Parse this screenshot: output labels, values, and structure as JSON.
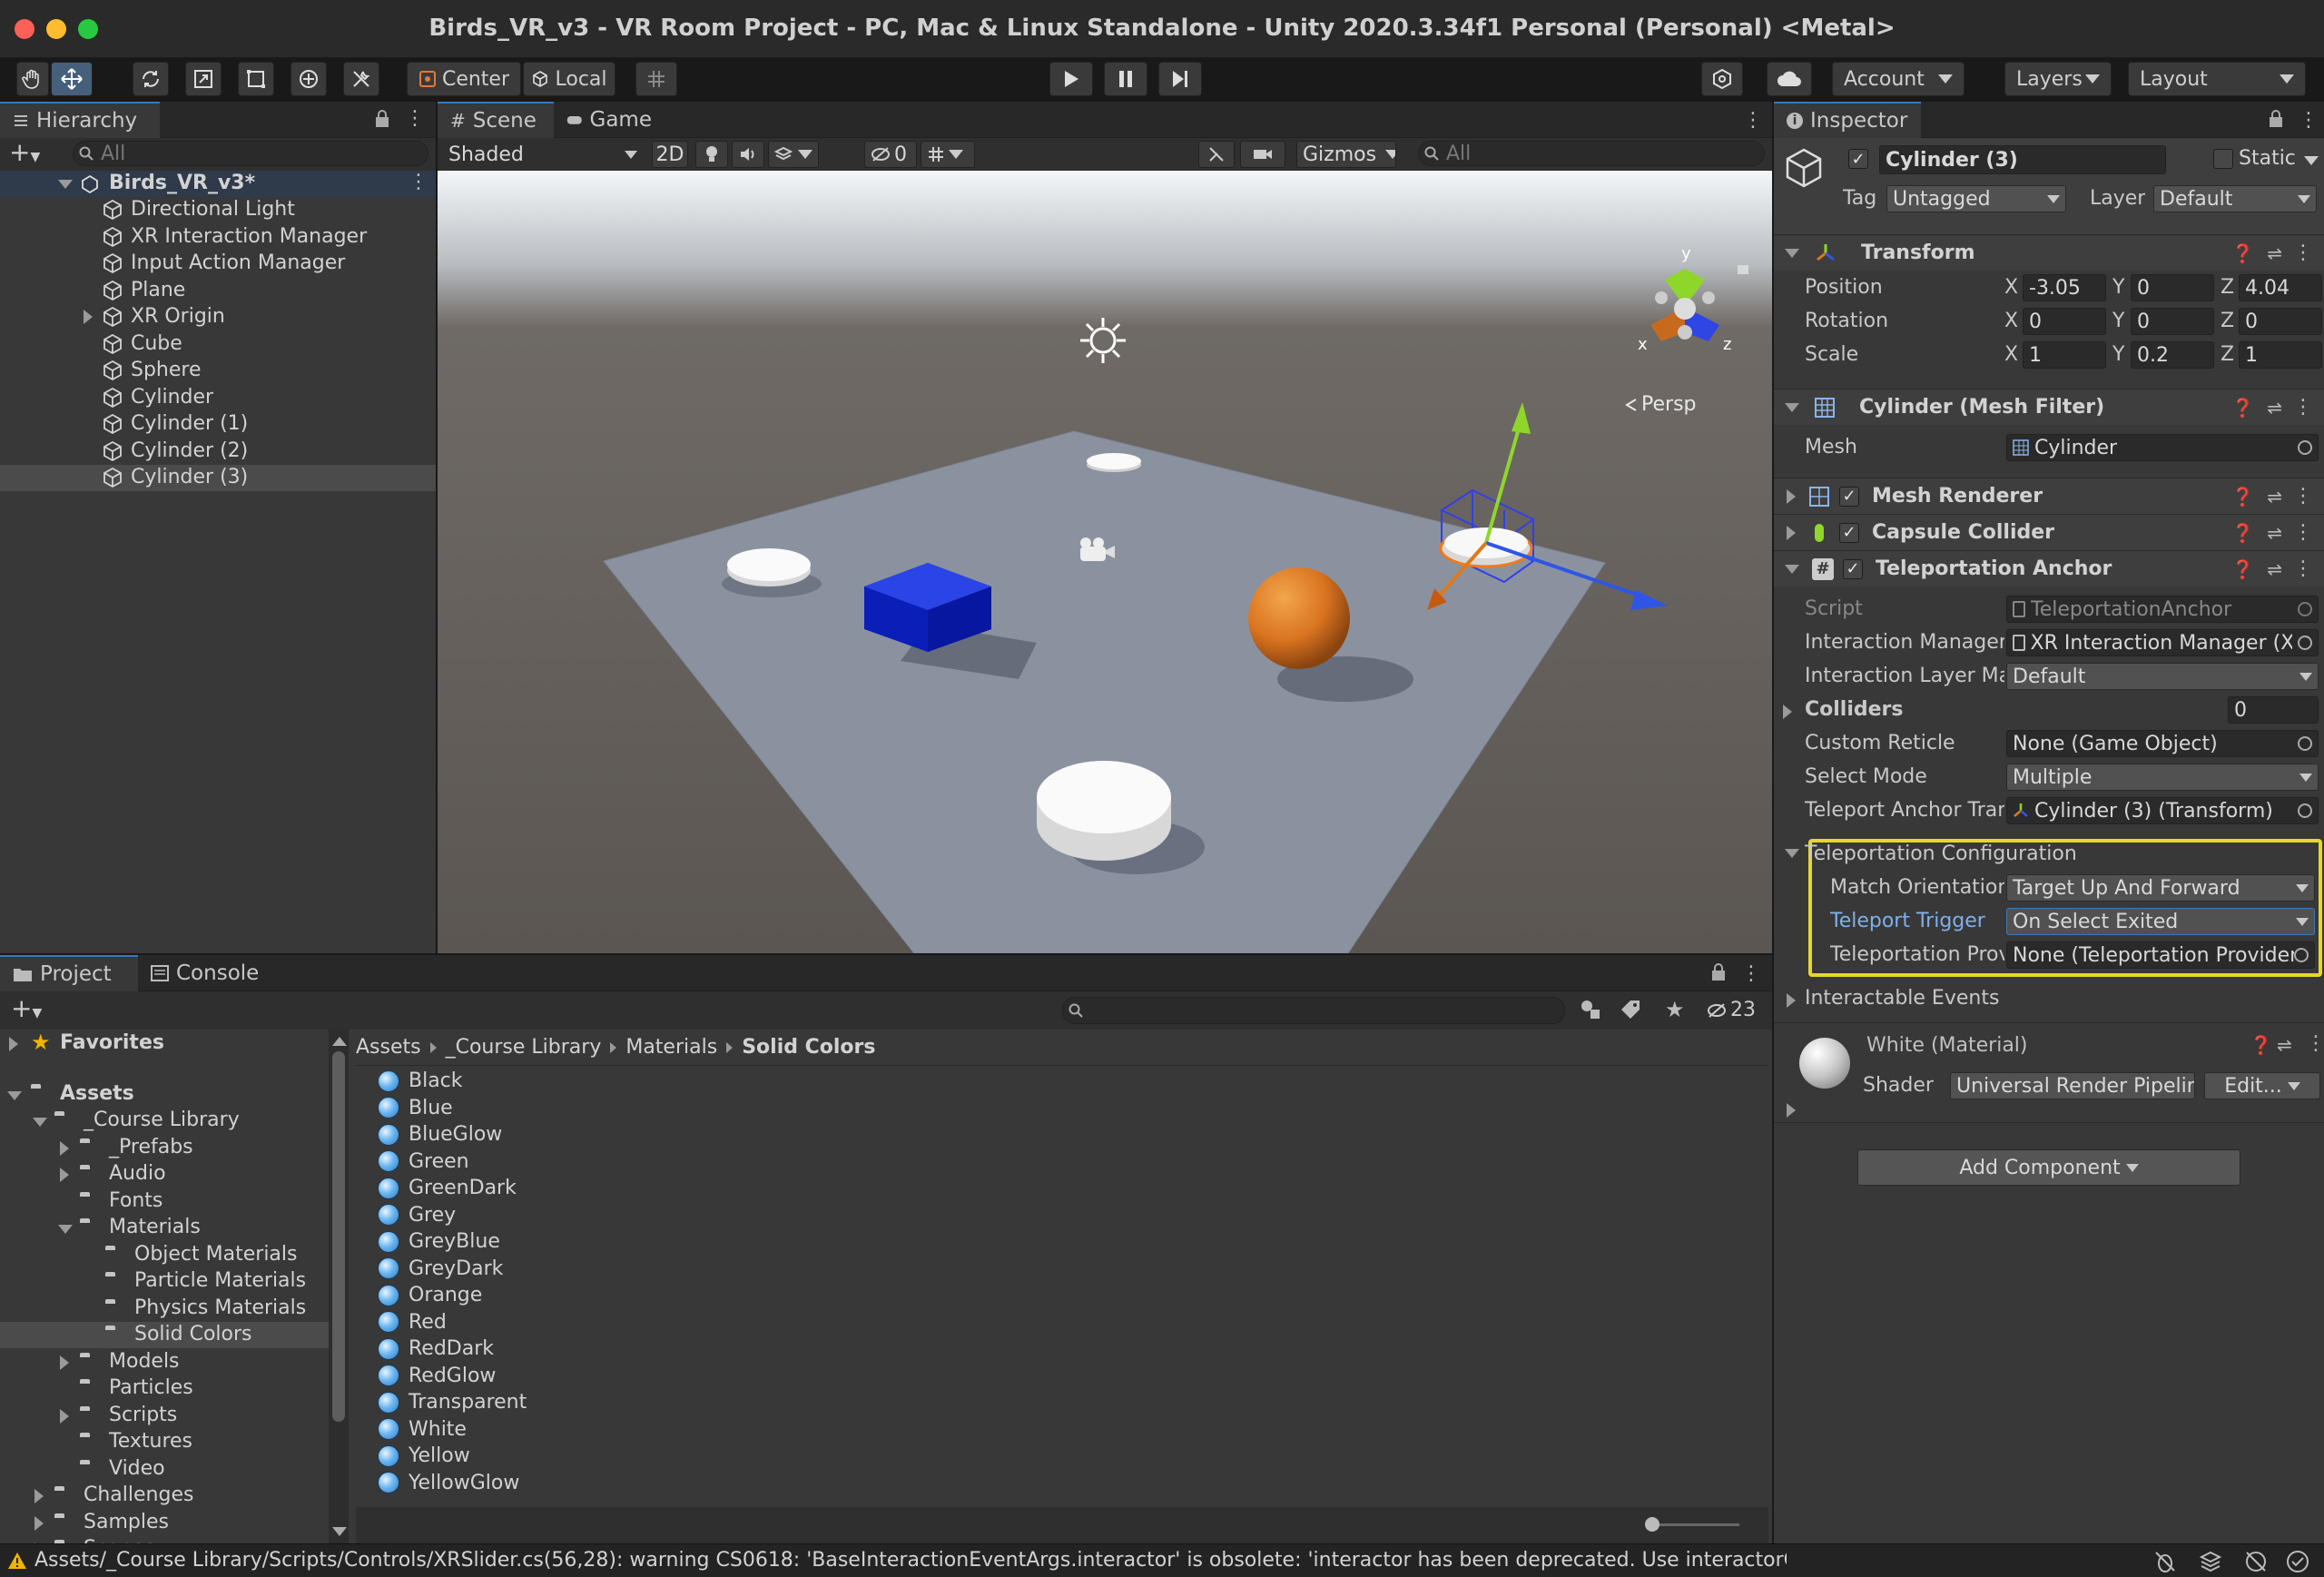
{
  "window": {
    "title": "Birds_VR_v3 - VR Room Project - PC, Mac & Linux Standalone - Unity 2020.3.34f1 Personal (Personal) <Metal>"
  },
  "toolbar": {
    "pivot": "Center",
    "space": "Local",
    "account": "Account",
    "layers": "Layers",
    "layout": "Layout"
  },
  "hierarchy": {
    "tab": "Hierarchy",
    "search_placeholder": "All",
    "scene_name": "Birds_VR_v3*",
    "items": [
      "Directional Light",
      "XR Interaction Manager",
      "Input Action Manager",
      "Plane",
      "XR Origin",
      "Cube",
      "Sphere",
      "Cylinder",
      "Cylinder (1)",
      "Cylinder (2)",
      "Cylinder (3)"
    ],
    "selected": "Cylinder (3)"
  },
  "scene": {
    "tab_scene": "Scene",
    "tab_game": "Game",
    "shading": "Shaded",
    "mode_2d": "2D",
    "hidden_count": "0",
    "gizmos": "Gizmos",
    "search_placeholder": "All",
    "persp": "Persp",
    "axis_x": "x",
    "axis_y": "y",
    "axis_z": "z"
  },
  "inspector": {
    "tab": "Inspector",
    "object_name": "Cylinder (3)",
    "static_label": "Static",
    "tag_label": "Tag",
    "tag_value": "Untagged",
    "layer_label": "Layer",
    "layer_value": "Default",
    "transform": {
      "title": "Transform",
      "position_label": "Position",
      "rotation_label": "Rotation",
      "scale_label": "Scale",
      "axis_x": "X",
      "axis_y": "Y",
      "axis_z": "Z",
      "position": [
        "-3.05",
        "0",
        "4.04"
      ],
      "rotation": [
        "0",
        "0",
        "0"
      ],
      "scale": [
        "1",
        "0.2",
        "1"
      ]
    },
    "mesh_filter": {
      "title": "Cylinder (Mesh Filter)",
      "mesh_label": "Mesh",
      "mesh_value": "Cylinder"
    },
    "mesh_renderer": {
      "title": "Mesh Renderer"
    },
    "capsule_collider": {
      "title": "Capsule Collider"
    },
    "teleport_anchor": {
      "title": "Teleportation Anchor",
      "script_label": "Script",
      "script_value": "TeleportationAnchor",
      "interaction_manager_label": "Interaction Manager",
      "interaction_manager_value": "XR Interaction Manager (XF",
      "layer_mask_label": "Interaction Layer Mas",
      "layer_mask_value": "Default",
      "colliders_label": "Colliders",
      "colliders_value": "0",
      "custom_reticle_label": "Custom Reticle",
      "custom_reticle_value": "None (Game Object)",
      "select_mode_label": "Select Mode",
      "select_mode_value": "Multiple",
      "anchor_transform_label": "Teleport Anchor Tran",
      "anchor_transform_value": "Cylinder (3) (Transform)",
      "config_label": "Teleportation Configuration",
      "match_orientation_label": "Match Orientation",
      "match_orientation_value": "Target Up And Forward",
      "teleport_trigger_label": "Teleport Trigger",
      "teleport_trigger_value": "On Select Exited",
      "provider_label": "Teleportation Prov",
      "provider_value": "None (Teleportation Provider",
      "events_label": "Interactable Events"
    },
    "material": {
      "name": "White (Material)",
      "shader_label": "Shader",
      "shader_value": "Universal Render Pipeline/L",
      "edit_label": "Edit..."
    },
    "add_component": "Add Component"
  },
  "project": {
    "tab_project": "Project",
    "tab_console": "Console",
    "hidden_count": "23",
    "favorites": "Favorites",
    "assets": "Assets",
    "tree": [
      {
        "label": "_Course Library",
        "depth": 1,
        "arrow": "down"
      },
      {
        "label": "_Prefabs",
        "depth": 2,
        "arrow": "right"
      },
      {
        "label": "Audio",
        "depth": 2,
        "arrow": "right"
      },
      {
        "label": "Fonts",
        "depth": 2,
        "arrow": "none"
      },
      {
        "label": "Materials",
        "depth": 2,
        "arrow": "down"
      },
      {
        "label": "Object Materials",
        "depth": 3,
        "arrow": "none"
      },
      {
        "label": "Particle Materials",
        "depth": 3,
        "arrow": "none"
      },
      {
        "label": "Physics Materials",
        "depth": 3,
        "arrow": "none"
      },
      {
        "label": "Solid Colors",
        "depth": 3,
        "arrow": "none"
      },
      {
        "label": "Models",
        "depth": 2,
        "arrow": "right"
      },
      {
        "label": "Particles",
        "depth": 2,
        "arrow": "none"
      },
      {
        "label": "Scripts",
        "depth": 2,
        "arrow": "right"
      },
      {
        "label": "Textures",
        "depth": 2,
        "arrow": "none"
      },
      {
        "label": "Video",
        "depth": 2,
        "arrow": "none"
      },
      {
        "label": "Challenges",
        "depth": 1,
        "arrow": "right"
      },
      {
        "label": "Samples",
        "depth": 1,
        "arrow": "right"
      },
      {
        "label": "Scenes",
        "depth": 1,
        "arrow": "right"
      }
    ],
    "selected_folder": "Solid Colors",
    "breadcrumb": [
      "Assets",
      "_Course Library",
      "Materials",
      "Solid Colors"
    ],
    "files": [
      "Black",
      "Blue",
      "BlueGlow",
      "Green",
      "GreenDark",
      "Grey",
      "GreyBlue",
      "GreyDark",
      "Orange",
      "Red",
      "RedDark",
      "RedGlow",
      "Transparent",
      "White",
      "Yellow",
      "YellowGlow"
    ]
  },
  "status": {
    "message": "Assets/_Course Library/Scripts/Controls/XRSlider.cs(56,28): warning CS0618: 'BaseInteractionEventArgs.interactor' is obsolete: 'interactor has been deprecated. Use interactorObject instead.'"
  },
  "colors": {
    "accent": "#3a79bb",
    "selection": "#46607c",
    "highlight_box": "#e6d72a",
    "warning": "#f0b400"
  }
}
